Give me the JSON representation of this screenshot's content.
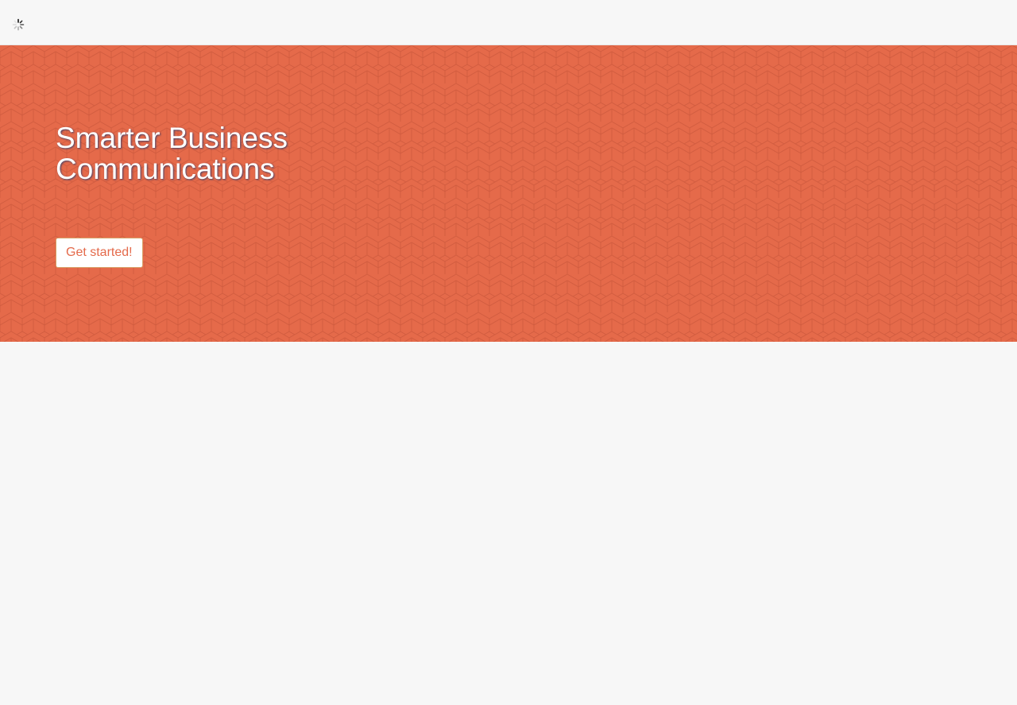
{
  "header": {
    "loading_icon": "spinner-icon"
  },
  "hero": {
    "title": "Smarter Business Communications",
    "cta_label": "Get started!",
    "background_color": "#e56a4a",
    "pattern_color": "#cf5a3d"
  },
  "colors": {
    "page_background": "#f7f7f7",
    "accent": "#e46a4b"
  }
}
